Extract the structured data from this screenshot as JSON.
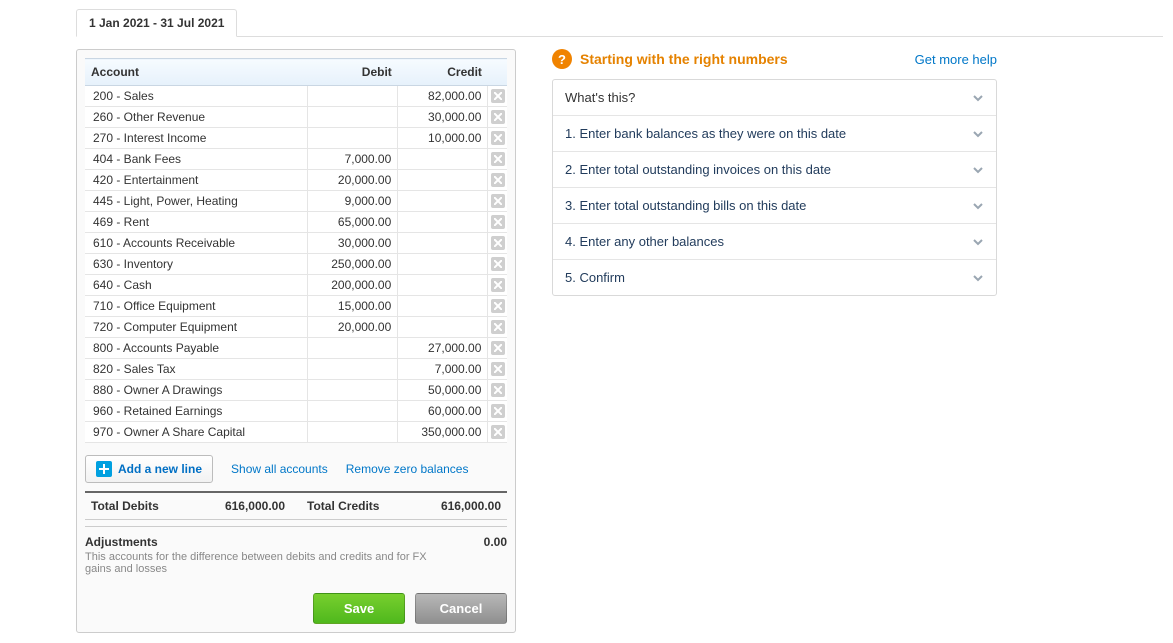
{
  "tab": {
    "label": "1 Jan 2021 - 31 Jul 2021"
  },
  "table": {
    "headers": {
      "account": "Account",
      "debit": "Debit",
      "credit": "Credit"
    },
    "rows": [
      {
        "account": "200 - Sales",
        "debit": "",
        "credit": "82,000.00"
      },
      {
        "account": "260 - Other Revenue",
        "debit": "",
        "credit": "30,000.00"
      },
      {
        "account": "270 - Interest Income",
        "debit": "",
        "credit": "10,000.00"
      },
      {
        "account": "404 - Bank Fees",
        "debit": "7,000.00",
        "credit": ""
      },
      {
        "account": "420 - Entertainment",
        "debit": "20,000.00",
        "credit": ""
      },
      {
        "account": "445 - Light, Power, Heating",
        "debit": "9,000.00",
        "credit": ""
      },
      {
        "account": "469 - Rent",
        "debit": "65,000.00",
        "credit": ""
      },
      {
        "account": "610 - Accounts Receivable",
        "debit": "30,000.00",
        "credit": ""
      },
      {
        "account": "630 - Inventory",
        "debit": "250,000.00",
        "credit": ""
      },
      {
        "account": "640 - Cash",
        "debit": "200,000.00",
        "credit": ""
      },
      {
        "account": "710 - Office Equipment",
        "debit": "15,000.00",
        "credit": ""
      },
      {
        "account": "720 - Computer Equipment",
        "debit": "20,000.00",
        "credit": ""
      },
      {
        "account": "800 - Accounts Payable",
        "debit": "",
        "credit": "27,000.00"
      },
      {
        "account": "820 - Sales Tax",
        "debit": "",
        "credit": "7,000.00"
      },
      {
        "account": "880 - Owner A Drawings",
        "debit": "",
        "credit": "50,000.00"
      },
      {
        "account": "960 - Retained Earnings",
        "debit": "",
        "credit": "60,000.00"
      },
      {
        "account": "970 - Owner A Share Capital",
        "debit": "",
        "credit": "350,000.00"
      }
    ]
  },
  "actions": {
    "add_line": "Add a new line",
    "show_all": "Show all accounts",
    "remove_zero": "Remove zero balances"
  },
  "totals": {
    "debits_label": "Total Debits",
    "debits_value": "616,000.00",
    "credits_label": "Total Credits",
    "credits_value": "616,000.00"
  },
  "adjustments": {
    "label": "Adjustments",
    "value": "0.00",
    "subtext": "This accounts for the difference between debits and credits and for FX gains and losses"
  },
  "buttons": {
    "save": "Save",
    "cancel": "Cancel"
  },
  "help": {
    "title": "Starting with the right numbers",
    "more": "Get more help",
    "items": [
      "What's this?",
      "1. Enter bank balances as they were on this date",
      "2. Enter total outstanding invoices on this date",
      "3. Enter total outstanding bills on this date",
      "4. Enter any other balances",
      "5. Confirm"
    ]
  }
}
